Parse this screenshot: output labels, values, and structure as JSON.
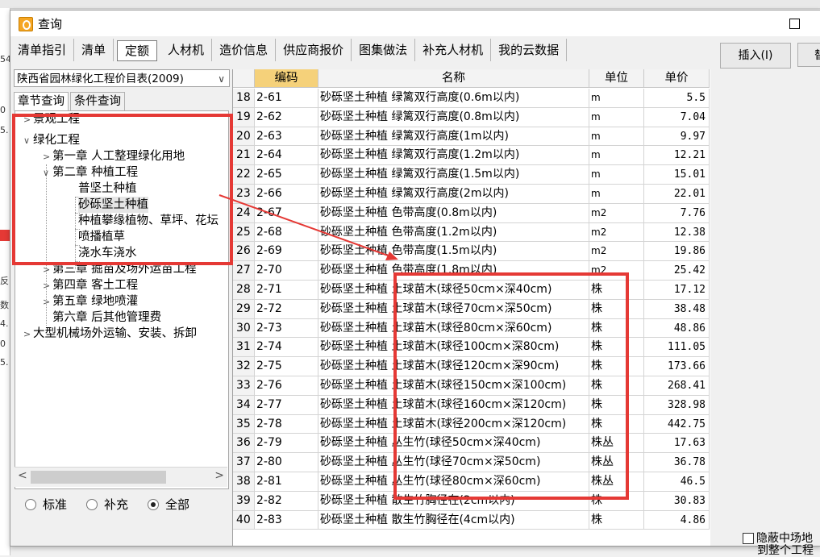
{
  "window": {
    "title": "查询"
  },
  "tabs": [
    "清单指引",
    "清单",
    "定额",
    "人材机",
    "造价信息",
    "供应商报价",
    "图集做法",
    "补充人材机",
    "我的云数据"
  ],
  "active_tab": "定额",
  "buttons": {
    "insert": "插入(I)",
    "extra": "替"
  },
  "library_select": "陕西省园林绿化工程价目表(2009)",
  "subtabs": [
    "章节查询",
    "条件查询"
  ],
  "tree": [
    {
      "label": "景观工程"
    },
    {
      "label": "绿化工程"
    },
    {
      "label": "第一章 人工整理绿化用地"
    },
    {
      "label": "第二章 种植工程"
    },
    {
      "label": "普坚土种植"
    },
    {
      "label": "砂砾坚土种植"
    },
    {
      "label": "种植攀缘植物、草坪、花坛"
    },
    {
      "label": "喷播植草"
    },
    {
      "label": "浇水车浇水"
    },
    {
      "label": "第三章 掘苗及场外运苗工程"
    },
    {
      "label": "第四章 客土工程"
    },
    {
      "label": "第五章 绿地喷灌"
    },
    {
      "label": "第六章 后其他管理费"
    },
    {
      "label": "大型机械场外运输、安装、拆卸"
    }
  ],
  "radio_options": [
    "标准",
    "补充",
    "全部"
  ],
  "radio_selected": "全部",
  "grid": {
    "headers": [
      "编码",
      "名称",
      "单位",
      "单价"
    ],
    "rows": [
      {
        "num": "18",
        "code": "2-61",
        "name": "砂砾坚土种植 绿篱双行高度(0.6m以内)",
        "unit": "m",
        "price": "5.5"
      },
      {
        "num": "19",
        "code": "2-62",
        "name": "砂砾坚土种植 绿篱双行高度(0.8m以内)",
        "unit": "m",
        "price": "7.04"
      },
      {
        "num": "20",
        "code": "2-63",
        "name": "砂砾坚土种植 绿篱双行高度(1m以内)",
        "unit": "m",
        "price": "9.97"
      },
      {
        "num": "21",
        "code": "2-64",
        "name": "砂砾坚土种植 绿篱双行高度(1.2m以内)",
        "unit": "m",
        "price": "12.21"
      },
      {
        "num": "22",
        "code": "2-65",
        "name": "砂砾坚土种植 绿篱双行高度(1.5m以内)",
        "unit": "m",
        "price": "15.01"
      },
      {
        "num": "23",
        "code": "2-66",
        "name": "砂砾坚土种植 绿篱双行高度(2m以内)",
        "unit": "m",
        "price": "22.01"
      },
      {
        "num": "24",
        "code": "2-67",
        "name": "砂砾坚土种植 色带高度(0.8m以内)",
        "unit": "m2",
        "price": "7.76"
      },
      {
        "num": "25",
        "code": "2-68",
        "name": "砂砾坚土种植 色带高度(1.2m以内)",
        "unit": "m2",
        "price": "12.38"
      },
      {
        "num": "26",
        "code": "2-69",
        "name": "砂砾坚土种植 色带高度(1.5m以内)",
        "unit": "m2",
        "price": "19.86"
      },
      {
        "num": "27",
        "code": "2-70",
        "name": "砂砾坚土种植 色带高度(1.8m以内)",
        "unit": "m2",
        "price": "25.42"
      },
      {
        "num": "28",
        "code": "2-71",
        "name": "砂砾坚土种植 土球苗木(球径50cm×深40cm)",
        "unit": "株",
        "price": "17.12"
      },
      {
        "num": "29",
        "code": "2-72",
        "name": "砂砾坚土种植 土球苗木(球径70cm×深50cm)",
        "unit": "株",
        "price": "38.48"
      },
      {
        "num": "30",
        "code": "2-73",
        "name": "砂砾坚土种植 土球苗木(球径80cm×深60cm)",
        "unit": "株",
        "price": "48.86"
      },
      {
        "num": "31",
        "code": "2-74",
        "name": "砂砾坚土种植 土球苗木(球径100cm×深80cm)",
        "unit": "株",
        "price": "111.05"
      },
      {
        "num": "32",
        "code": "2-75",
        "name": "砂砾坚土种植 土球苗木(球径120cm×深90cm)",
        "unit": "株",
        "price": "173.66"
      },
      {
        "num": "33",
        "code": "2-76",
        "name": "砂砾坚土种植 土球苗木(球径150cm×深100cm)",
        "unit": "株",
        "price": "268.41"
      },
      {
        "num": "34",
        "code": "2-77",
        "name": "砂砾坚土种植 土球苗木(球径160cm×深120cm)",
        "unit": "株",
        "price": "328.98"
      },
      {
        "num": "35",
        "code": "2-78",
        "name": "砂砾坚土种植 土球苗木(球径200cm×深120cm)",
        "unit": "株",
        "price": "442.75"
      },
      {
        "num": "36",
        "code": "2-79",
        "name": "砂砾坚土种植 丛生竹(球径50cm×深40cm)",
        "unit": "株丛",
        "price": "17.63"
      },
      {
        "num": "37",
        "code": "2-80",
        "name": "砂砾坚土种植 丛生竹(球径70cm×深50cm)",
        "unit": "株丛",
        "price": "36.78"
      },
      {
        "num": "38",
        "code": "2-81",
        "name": "砂砾坚土种植 丛生竹(球径80cm×深60cm)",
        "unit": "株丛",
        "price": "46.5"
      },
      {
        "num": "39",
        "code": "2-82",
        "name": "砂砾坚土种植 散生竹胸径在(2cm以内)",
        "unit": "株",
        "price": "30.83"
      },
      {
        "num": "40",
        "code": "2-83",
        "name": "砂砾坚土种植 散生竹胸径在(4cm以内)",
        "unit": "株",
        "price": "4.86"
      }
    ]
  },
  "checkbox": {
    "line1": "隐蔽中场地",
    "line2": "到整个工程"
  },
  "colors": {
    "annotation": "#e53935",
    "header_highlight": "#f5d17a",
    "accent": "#f5a623"
  },
  "bg_fragments": [
    "54",
    "0",
    "5.",
    "反",
    "数",
    "4.",
    "0",
    "5."
  ]
}
